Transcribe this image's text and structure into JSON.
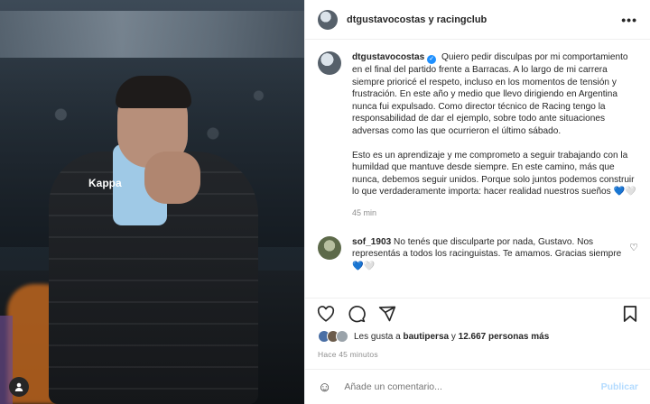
{
  "header": {
    "title": "dtgustavocostas y racingclub",
    "more_icon": "more-horizontal-icon"
  },
  "post": {
    "username": "dtgustavocostas",
    "verified": true,
    "text1": "Quiero pedir disculpas por mi comportamiento en el final del partido frente a Barracas. A lo largo de mi carrera siempre prioricé el respeto, incluso en los momentos de tensión y frustración. En este año y medio que llevo dirigiendo en Argentina nunca fui expulsado. Como director técnico de Racing tengo la responsabilidad de dar el ejemplo, sobre todo ante situaciones adversas como las que ocurrieron el último sábado.",
    "text2": "Esto es un aprendizaje y me comprometo a seguir trabajando con la humildad que mantuve desde siempre. En este camino, más que nunca, debemos seguir unidos. Porque solo juntos podemos construir lo que verdaderamente importa: hacer realidad nuestros sueños 💙🤍",
    "time": "45 min"
  },
  "comment": {
    "username": "sof_1903",
    "text": "No tenés que disculparte por nada, Gustavo. Nos representás a todos los racinguistas. Te amamos. Gracias siempre 💙🤍"
  },
  "likes": {
    "prefix": "Les gusta a",
    "user": "bautipersa",
    "joiner": "y",
    "count": "12.667 personas más"
  },
  "ago": "Hace 45 minutos",
  "add_comment": {
    "placeholder": "Añade un comentario...",
    "publish": "Publicar"
  },
  "photo": {
    "brand_text": "Kappa"
  }
}
